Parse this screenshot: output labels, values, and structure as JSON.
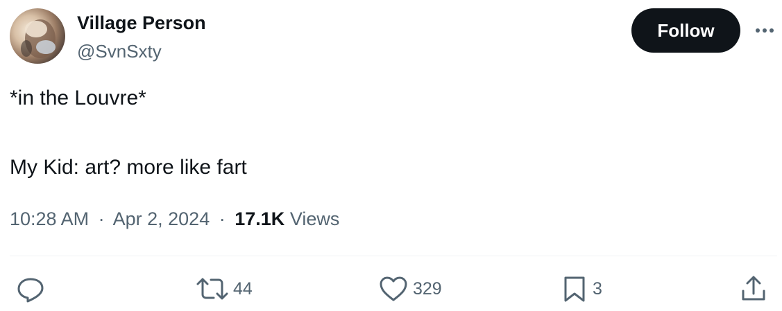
{
  "author": {
    "display_name": "Village Person",
    "handle": "@SvnSxty"
  },
  "header": {
    "follow_label": "Follow",
    "more_icon": "more-horizontal-icon"
  },
  "tweet": {
    "line1": "*in the Louvre*",
    "line2": "My Kid: art? more like fart"
  },
  "meta": {
    "time": "10:28 AM",
    "date": "Apr 2, 2024",
    "separator": "·",
    "views_count": "17.1K",
    "views_label": "Views"
  },
  "actions": {
    "reply": {
      "icon": "reply-icon",
      "count": ""
    },
    "retweet": {
      "icon": "retweet-icon",
      "count": "44"
    },
    "like": {
      "icon": "heart-icon",
      "count": "329"
    },
    "bookmark": {
      "icon": "bookmark-icon",
      "count": "3"
    },
    "share": {
      "icon": "share-icon",
      "count": ""
    }
  },
  "colors": {
    "text_primary": "#0f1419",
    "text_secondary": "#536471",
    "divider": "#eff3f4",
    "follow_bg": "#0f1419",
    "follow_text": "#ffffff"
  }
}
